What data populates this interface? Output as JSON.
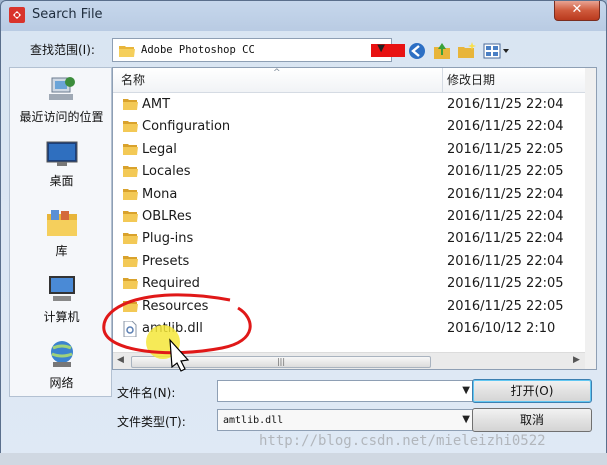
{
  "window": {
    "title": "Search File",
    "close_glyph": "✕"
  },
  "lookin": {
    "label": "查找范围(I):",
    "value": "Adobe Photoshop CC"
  },
  "toolbar": {
    "icons": [
      "back-icon",
      "up-folder-icon",
      "new-folder-icon",
      "view-menu-icon"
    ]
  },
  "places": [
    {
      "label": "最近访问的位置",
      "icon": "recent-places-icon"
    },
    {
      "label": "桌面",
      "icon": "desktop-icon"
    },
    {
      "label": "库",
      "icon": "libraries-icon"
    },
    {
      "label": "计算机",
      "icon": "computer-icon"
    },
    {
      "label": "网络",
      "icon": "network-icon"
    }
  ],
  "columns": {
    "name": "名称",
    "date": "修改日期"
  },
  "files": [
    {
      "name": "AMT",
      "date": "2016/11/25 22:04",
      "type": "folder"
    },
    {
      "name": "Configuration",
      "date": "2016/11/25 22:04",
      "type": "folder"
    },
    {
      "name": "Legal",
      "date": "2016/11/25 22:05",
      "type": "folder"
    },
    {
      "name": "Locales",
      "date": "2016/11/25 22:05",
      "type": "folder"
    },
    {
      "name": "Mona",
      "date": "2016/11/25 22:04",
      "type": "folder"
    },
    {
      "name": "OBLRes",
      "date": "2016/11/25 22:04",
      "type": "folder"
    },
    {
      "name": "Plug-ins",
      "date": "2016/11/25 22:04",
      "type": "folder"
    },
    {
      "name": "Presets",
      "date": "2016/11/25 22:04",
      "type": "folder"
    },
    {
      "name": "Required",
      "date": "2016/11/25 22:05",
      "type": "folder"
    },
    {
      "name": "Resources",
      "date": "2016/11/25 22:05",
      "type": "folder"
    },
    {
      "name": "amtlib.dll",
      "date": "2016/10/12 2:10",
      "type": "dll"
    }
  ],
  "filename": {
    "label": "文件名(N):",
    "value": ""
  },
  "filetype": {
    "label": "文件类型(T):",
    "value": "amtlib.dll"
  },
  "buttons": {
    "open": "打开(O)",
    "cancel": "取消"
  },
  "watermark": "http://blog.csdn.net/mieleizhi0522",
  "colors": {
    "annotation_red": "#e01818",
    "highlight_yellow": "#f5e63a"
  }
}
